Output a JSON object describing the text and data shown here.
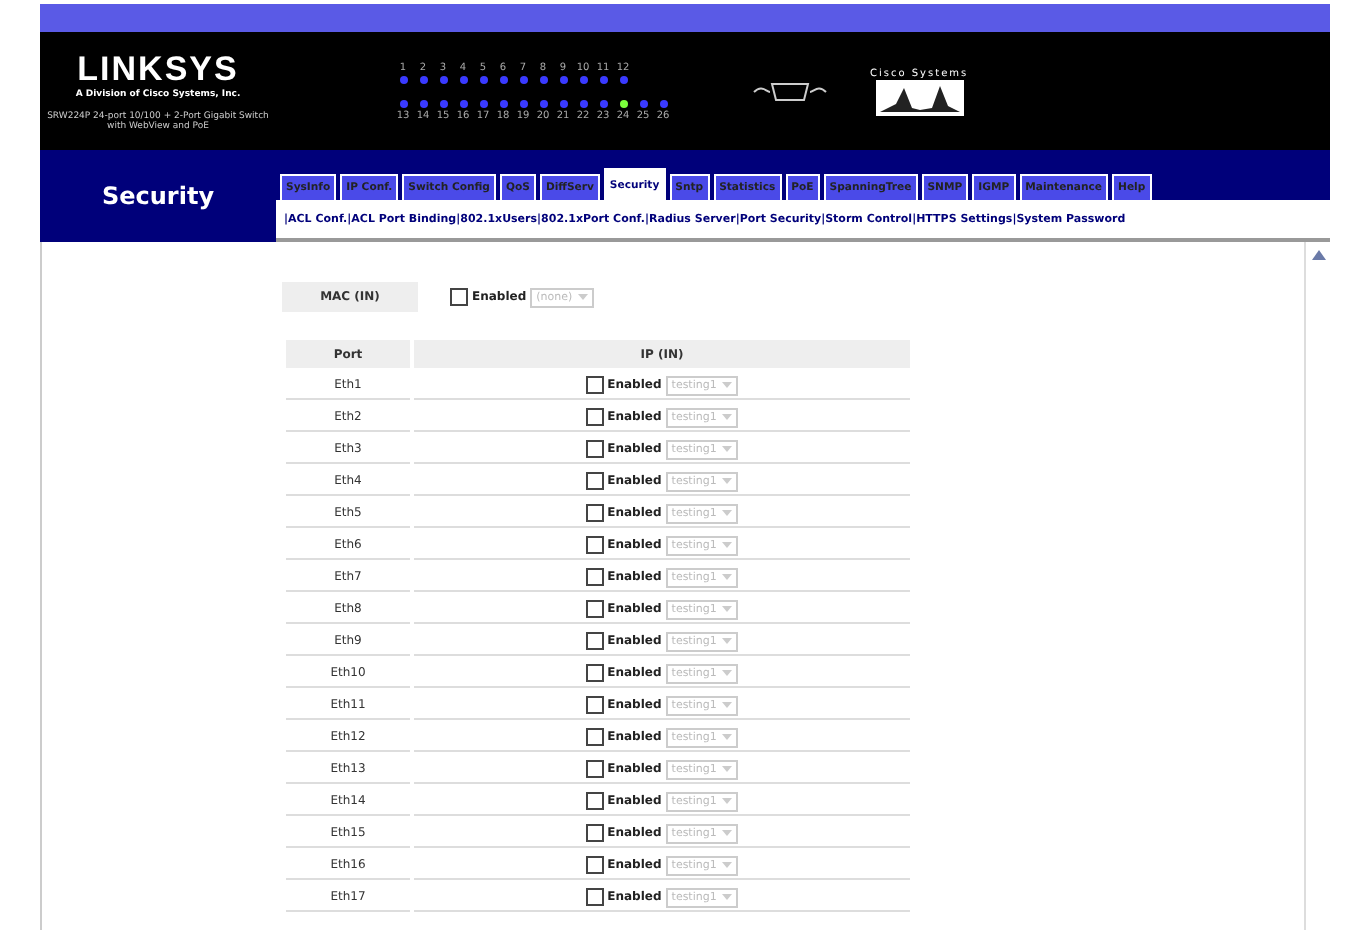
{
  "brand": {
    "logo": "LINKSYS",
    "tagline": "A Division of Cisco Systems, Inc.",
    "model": "SRW224P 24-port 10/100 + 2-Port Gigabit Switch with WebView and PoE",
    "partner": "Cisco Systems"
  },
  "ports_top": [
    {
      "label": "1",
      "active": false
    },
    {
      "label": "2",
      "active": false
    },
    {
      "label": "3",
      "active": false
    },
    {
      "label": "4",
      "active": false
    },
    {
      "label": "5",
      "active": false
    },
    {
      "label": "6",
      "active": false
    },
    {
      "label": "7",
      "active": false
    },
    {
      "label": "8",
      "active": false
    },
    {
      "label": "9",
      "active": false
    },
    {
      "label": "10",
      "active": false
    },
    {
      "label": "11",
      "active": false
    },
    {
      "label": "12",
      "active": false
    }
  ],
  "ports_bottom": [
    {
      "label": "13",
      "active": false
    },
    {
      "label": "14",
      "active": false
    },
    {
      "label": "15",
      "active": false
    },
    {
      "label": "16",
      "active": false
    },
    {
      "label": "17",
      "active": false
    },
    {
      "label": "18",
      "active": false
    },
    {
      "label": "19",
      "active": false
    },
    {
      "label": "20",
      "active": false
    },
    {
      "label": "21",
      "active": false
    },
    {
      "label": "22",
      "active": false
    },
    {
      "label": "23",
      "active": false
    },
    {
      "label": "24",
      "active": true
    },
    {
      "label": "25",
      "active": false
    },
    {
      "label": "26",
      "active": false
    }
  ],
  "section": "Security",
  "tabs": [
    {
      "label": "SysInfo",
      "selected": false
    },
    {
      "label": "IP Conf.",
      "selected": false
    },
    {
      "label": "Switch Config",
      "selected": false
    },
    {
      "label": "QoS",
      "selected": false
    },
    {
      "label": "DiffServ",
      "selected": false
    },
    {
      "label": "Security",
      "selected": true
    },
    {
      "label": "Sntp",
      "selected": false
    },
    {
      "label": "Statistics",
      "selected": false
    },
    {
      "label": "PoE",
      "selected": false
    },
    {
      "label": "SpanningTree",
      "selected": false
    },
    {
      "label": "SNMP",
      "selected": false
    },
    {
      "label": "IGMP",
      "selected": false
    },
    {
      "label": "Maintenance",
      "selected": false
    },
    {
      "label": "Help",
      "selected": false
    }
  ],
  "subnav": {
    "separator": "|",
    "items": [
      "ACL Conf.",
      "ACL Port Binding",
      "802.1xUsers",
      "802.1xPort Conf.",
      "Radius Server",
      "Port Security",
      "Storm Control",
      "HTTPS Settings",
      "System Password"
    ]
  },
  "mac": {
    "label": "MAC (IN)",
    "checkbox": "Enabled",
    "checked": false,
    "select": "(none)",
    "disabled": true
  },
  "table": {
    "columns": [
      "Port",
      "IP (IN)"
    ],
    "rows": [
      {
        "port": "Eth1",
        "checkbox": "Enabled",
        "checked": false,
        "select": "testing1",
        "disabled": true
      },
      {
        "port": "Eth2",
        "checkbox": "Enabled",
        "checked": false,
        "select": "testing1",
        "disabled": true
      },
      {
        "port": "Eth3",
        "checkbox": "Enabled",
        "checked": false,
        "select": "testing1",
        "disabled": true
      },
      {
        "port": "Eth4",
        "checkbox": "Enabled",
        "checked": false,
        "select": "testing1",
        "disabled": true
      },
      {
        "port": "Eth5",
        "checkbox": "Enabled",
        "checked": false,
        "select": "testing1",
        "disabled": true
      },
      {
        "port": "Eth6",
        "checkbox": "Enabled",
        "checked": false,
        "select": "testing1",
        "disabled": true
      },
      {
        "port": "Eth7",
        "checkbox": "Enabled",
        "checked": false,
        "select": "testing1",
        "disabled": true
      },
      {
        "port": "Eth8",
        "checkbox": "Enabled",
        "checked": false,
        "select": "testing1",
        "disabled": true
      },
      {
        "port": "Eth9",
        "checkbox": "Enabled",
        "checked": false,
        "select": "testing1",
        "disabled": true
      },
      {
        "port": "Eth10",
        "checkbox": "Enabled",
        "checked": false,
        "select": "testing1",
        "disabled": true
      },
      {
        "port": "Eth11",
        "checkbox": "Enabled",
        "checked": false,
        "select": "testing1",
        "disabled": true
      },
      {
        "port": "Eth12",
        "checkbox": "Enabled",
        "checked": false,
        "select": "testing1",
        "disabled": true
      },
      {
        "port": "Eth13",
        "checkbox": "Enabled",
        "checked": false,
        "select": "testing1",
        "disabled": true
      },
      {
        "port": "Eth14",
        "checkbox": "Enabled",
        "checked": false,
        "select": "testing1",
        "disabled": true
      },
      {
        "port": "Eth15",
        "checkbox": "Enabled",
        "checked": false,
        "select": "testing1",
        "disabled": true
      },
      {
        "port": "Eth16",
        "checkbox": "Enabled",
        "checked": false,
        "select": "testing1",
        "disabled": true
      },
      {
        "port": "Eth17",
        "checkbox": "Enabled",
        "checked": false,
        "select": "testing1",
        "disabled": true
      }
    ]
  }
}
